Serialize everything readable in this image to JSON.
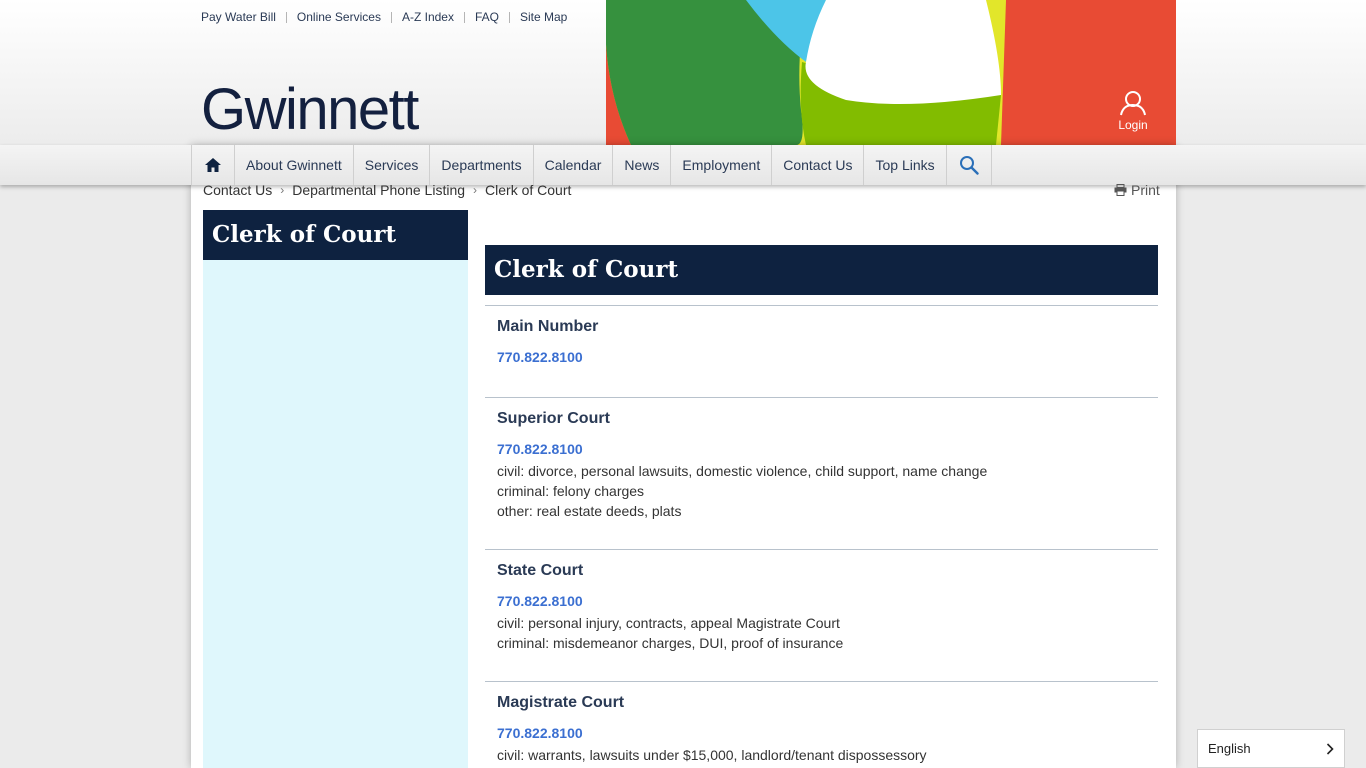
{
  "utility_links": [
    "Pay Water Bill",
    "Online Services",
    "A-Z Index",
    "FAQ",
    "Site Map"
  ],
  "logo_text": "Gwinnett",
  "login_label": "Login",
  "nav": {
    "items": [
      "About Gwinnett",
      "Services",
      "Departments",
      "Calendar",
      "News",
      "Employment",
      "Contact Us",
      "Top Links"
    ]
  },
  "breadcrumb": [
    "Contact Us",
    "Departmental Phone Listing",
    "Clerk of Court"
  ],
  "print_label": "Print",
  "sidebar_title": "Clerk of Court",
  "main_title": "Clerk of Court",
  "entries": [
    {
      "heading": "Main Number",
      "phone": "770.822.8100",
      "lines": []
    },
    {
      "heading": "Superior Court",
      "phone": "770.822.8100",
      "lines": [
        "civil: divorce, personal lawsuits, domestic violence, child support, name change",
        "criminal: felony charges",
        "other: real estate deeds, plats"
      ]
    },
    {
      "heading": "State Court",
      "phone": "770.822.8100",
      "lines": [
        "civil: personal injury, contracts, appeal Magistrate Court",
        "criminal: misdemeanor charges, DUI, proof of insurance"
      ]
    },
    {
      "heading": "Magistrate Court",
      "phone": "770.822.8100",
      "lines": [
        "civil: warrants, lawsuits under $15,000, landlord/tenant dispossessory"
      ]
    }
  ],
  "language": "English",
  "colors": {
    "navy": "#0e2240",
    "sidebar_bg": "#dff7fc",
    "phone_link": "#3b6fd1",
    "banner_green": "#36913e",
    "banner_lime": "#82bc00",
    "banner_yellow": "#e2e62a",
    "banner_red": "#e84b34",
    "banner_cyan": "#4cc5e8"
  }
}
